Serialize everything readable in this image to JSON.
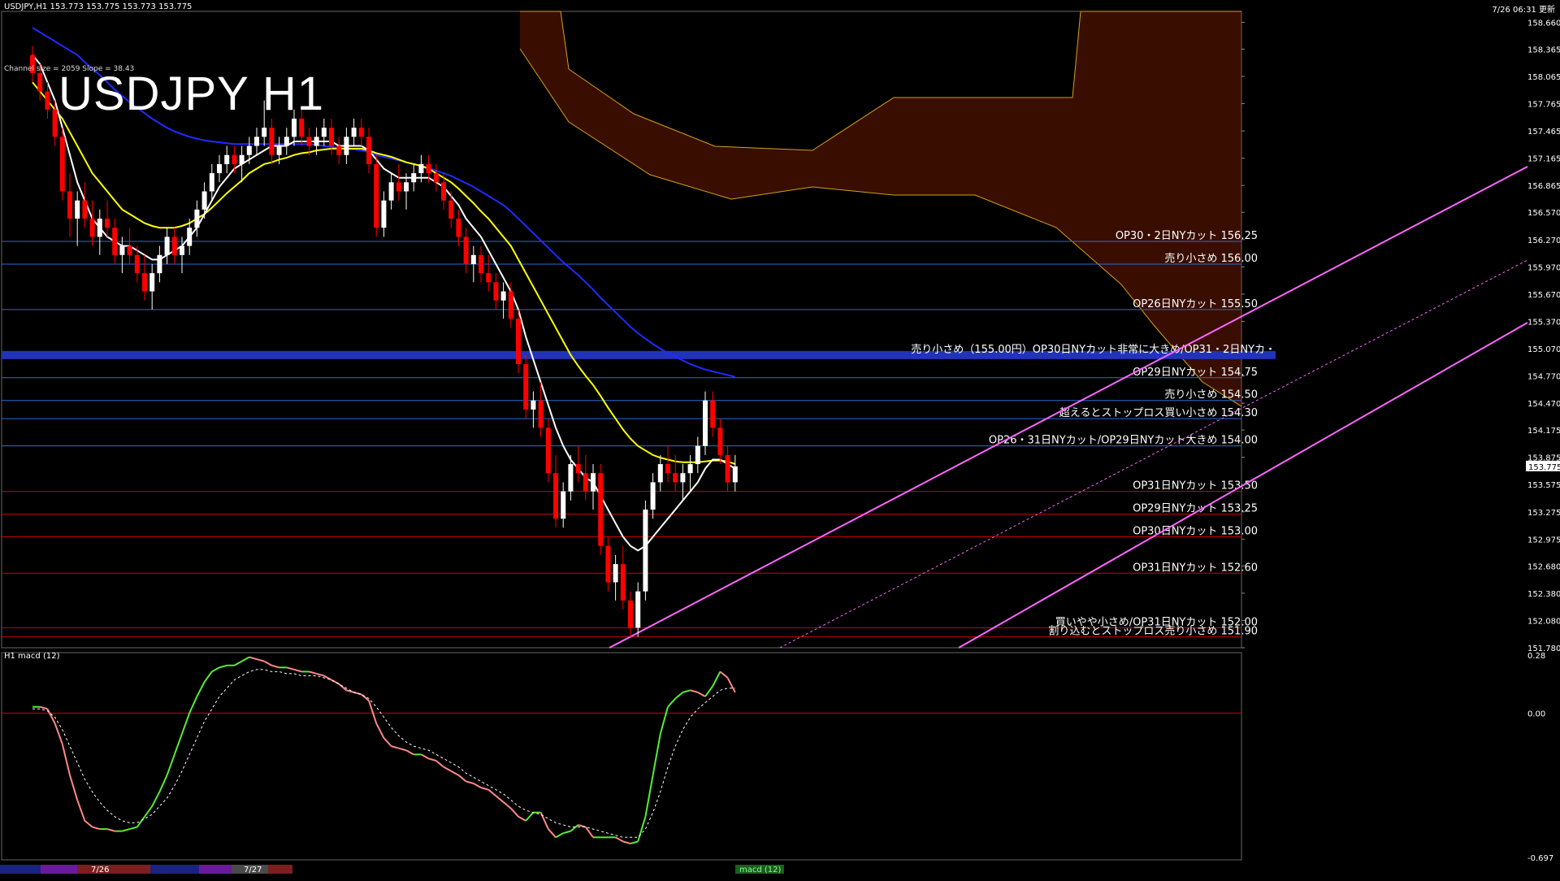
{
  "header": {
    "symbol_line": "USDJPY,H1  153.773 153.775 153.773 153.775",
    "timestamp": "7/26 06:31 更新",
    "indicator_note": "Channel size = 2059 Slope = 38.43",
    "big_title": "USDJPY H1",
    "macd_title": "H1  macd (12)"
  },
  "colors": {
    "background": "#000000",
    "bull_candle": "#ffffff",
    "bear_candle": "#ff0000",
    "sma_white": "#ffffff",
    "sma_yellow": "#ffff00",
    "sma_blue": "#1e2bff",
    "chikou_green": "#22cc22",
    "bollinger_red": "#cc0000",
    "kumo": "#cc3300",
    "channel_pink": "#ff66ff",
    "hline_blue": "#2a6dd9",
    "hline_red": "#cc0000",
    "macd_green": "#55ee33",
    "macd_pink": "#ff8888"
  },
  "chart_data": {
    "type": "candlestick",
    "ylim": [
      151.78,
      158.78
    ],
    "y_ticks": [
      "158.660",
      "158.365",
      "158.065",
      "157.765",
      "157.465",
      "157.165",
      "156.865",
      "156.570",
      "156.270",
      "155.970",
      "155.670",
      "155.370",
      "155.070",
      "154.770",
      "154.470",
      "154.175",
      "153.875",
      "153.575",
      "153.275",
      "152.975",
      "152.680",
      "152.380",
      "152.080",
      "151.780"
    ],
    "current_price": "153.775",
    "x_labels": [],
    "levels": [
      {
        "price": 156.25,
        "label": "OP30・2日NYカット 156.25",
        "color": "#2a6dd9"
      },
      {
        "price": 156.0,
        "label": "売り小さめ 156.00",
        "color": "#2a6dd9"
      },
      {
        "price": 155.5,
        "label": "OP26日NYカット 155.50",
        "color": "#2a6dd9"
      },
      {
        "price": 155.0,
        "label": "売り小さめ（155.00円）OP30日NYカット非常に大きめ/OP31・2日NYカ・",
        "color": "#2233bb",
        "band": true
      },
      {
        "price": 154.75,
        "label": "OP29日NYカット 154.75",
        "color": "#2a6dd9"
      },
      {
        "price": 154.5,
        "label": "売り小さめ 154.50",
        "color": "#2a6dd9"
      },
      {
        "price": 154.3,
        "label": "超えるとストップロス買い小さめ 154.30",
        "color": "#2a6dd9"
      },
      {
        "price": 154.0,
        "label": "OP26・31日NYカット/OP29日NYカット大きめ 154.00",
        "color": "#2a6dd9"
      },
      {
        "price": 153.5,
        "label": "OP31日NYカット 153.50",
        "color": "#cc0000"
      },
      {
        "price": 153.25,
        "label": "OP29日NYカット 153.25",
        "color": "#cc0000"
      },
      {
        "price": 153.0,
        "label": "OP30日NYカット 153.00",
        "color": "#cc0000"
      },
      {
        "price": 152.6,
        "label": "OP31日NYカット 152.60",
        "color": "#cc0000"
      },
      {
        "price": 152.0,
        "label": "買いやや小さめ/OP31日NYカット 152.00",
        "color": "#cc0000"
      },
      {
        "price": 151.9,
        "label": "割り込むとストップロス売り小さめ 151.90",
        "color": "#cc0000"
      }
    ],
    "candles": [
      [
        158.3,
        158.4,
        158.0,
        158.1
      ],
      [
        158.1,
        158.2,
        157.8,
        157.9
      ],
      [
        157.9,
        158.0,
        157.6,
        157.7
      ],
      [
        157.7,
        157.8,
        157.3,
        157.4
      ],
      [
        157.4,
        157.5,
        156.7,
        156.8
      ],
      [
        156.8,
        157.0,
        156.3,
        156.5
      ],
      [
        156.5,
        156.8,
        156.2,
        156.7
      ],
      [
        156.7,
        156.9,
        156.4,
        156.5
      ],
      [
        156.5,
        156.7,
        156.2,
        156.3
      ],
      [
        156.3,
        156.6,
        156.1,
        156.5
      ],
      [
        156.5,
        156.7,
        156.3,
        156.4
      ],
      [
        156.4,
        156.5,
        156.0,
        156.1
      ],
      [
        156.1,
        156.3,
        155.9,
        156.2
      ],
      [
        156.2,
        156.4,
        156.0,
        156.1
      ],
      [
        156.1,
        156.2,
        155.8,
        155.9
      ],
      [
        155.9,
        156.1,
        155.6,
        155.7
      ],
      [
        155.7,
        156.0,
        155.5,
        155.9
      ],
      [
        155.9,
        156.2,
        155.8,
        156.1
      ],
      [
        156.1,
        156.4,
        156.0,
        156.3
      ],
      [
        156.3,
        156.4,
        156.0,
        156.1
      ],
      [
        156.1,
        156.3,
        155.9,
        156.2
      ],
      [
        156.2,
        156.5,
        156.1,
        156.4
      ],
      [
        156.4,
        156.7,
        156.3,
        156.6
      ],
      [
        156.6,
        156.9,
        156.5,
        156.8
      ],
      [
        156.8,
        157.1,
        156.7,
        157.0
      ],
      [
        157.0,
        157.2,
        156.9,
        157.1
      ],
      [
        157.1,
        157.3,
        157.0,
        157.2
      ],
      [
        157.2,
        157.3,
        157.0,
        157.1
      ],
      [
        157.1,
        157.3,
        156.9,
        157.2
      ],
      [
        157.2,
        157.4,
        157.1,
        157.3
      ],
      [
        157.3,
        157.5,
        157.2,
        157.4
      ],
      [
        157.4,
        157.8,
        157.3,
        157.5
      ],
      [
        157.5,
        157.6,
        157.1,
        157.2
      ],
      [
        157.2,
        157.4,
        157.1,
        157.3
      ],
      [
        157.3,
        157.5,
        157.2,
        157.4
      ],
      [
        157.4,
        157.7,
        157.3,
        157.6
      ],
      [
        157.6,
        157.7,
        157.3,
        157.4
      ],
      [
        157.4,
        157.5,
        157.2,
        157.3
      ],
      [
        157.3,
        157.5,
        157.2,
        157.4
      ],
      [
        157.4,
        157.6,
        157.3,
        157.5
      ],
      [
        157.5,
        157.6,
        157.2,
        157.3
      ],
      [
        157.3,
        157.4,
        157.1,
        157.2
      ],
      [
        157.2,
        157.5,
        157.1,
        157.4
      ],
      [
        157.4,
        157.6,
        157.3,
        157.5
      ],
      [
        157.5,
        157.6,
        157.3,
        157.4
      ],
      [
        157.4,
        157.5,
        157.0,
        157.1
      ],
      [
        157.1,
        157.2,
        156.3,
        156.4
      ],
      [
        156.4,
        156.8,
        156.3,
        156.7
      ],
      [
        156.7,
        157.0,
        156.6,
        156.9
      ],
      [
        156.9,
        157.1,
        156.7,
        156.8
      ],
      [
        156.8,
        157.0,
        156.6,
        156.9
      ],
      [
        156.9,
        157.1,
        156.8,
        157.0
      ],
      [
        157.0,
        157.2,
        156.9,
        157.1
      ],
      [
        157.1,
        157.2,
        156.9,
        157.0
      ],
      [
        157.0,
        157.1,
        156.8,
        156.9
      ],
      [
        156.9,
        157.0,
        156.6,
        156.7
      ],
      [
        156.7,
        156.8,
        156.4,
        156.5
      ],
      [
        156.5,
        156.6,
        156.2,
        156.3
      ],
      [
        156.3,
        156.4,
        155.9,
        156.0
      ],
      [
        156.0,
        156.2,
        155.8,
        156.1
      ],
      [
        156.1,
        156.2,
        155.8,
        155.9
      ],
      [
        155.9,
        156.1,
        155.7,
        155.8
      ],
      [
        155.8,
        155.9,
        155.5,
        155.6
      ],
      [
        155.6,
        155.8,
        155.4,
        155.7
      ],
      [
        155.7,
        155.8,
        155.3,
        155.4
      ],
      [
        155.4,
        155.5,
        154.8,
        154.9
      ],
      [
        154.9,
        155.0,
        154.3,
        154.4
      ],
      [
        154.4,
        154.6,
        154.2,
        154.5
      ],
      [
        154.5,
        154.7,
        154.1,
        154.2
      ],
      [
        154.2,
        154.3,
        153.6,
        153.7
      ],
      [
        153.7,
        153.9,
        153.1,
        153.2
      ],
      [
        153.2,
        153.6,
        153.1,
        153.5
      ],
      [
        153.5,
        153.9,
        153.4,
        153.8
      ],
      [
        153.8,
        154.0,
        153.6,
        153.7
      ],
      [
        153.7,
        153.9,
        153.4,
        153.5
      ],
      [
        153.5,
        153.8,
        153.3,
        153.7
      ],
      [
        153.7,
        153.8,
        152.8,
        152.9
      ],
      [
        152.9,
        153.0,
        152.4,
        152.5
      ],
      [
        152.5,
        152.8,
        152.3,
        152.7
      ],
      [
        152.7,
        152.9,
        152.2,
        152.3
      ],
      [
        152.3,
        152.4,
        151.9,
        152.0
      ],
      [
        152.0,
        152.5,
        151.9,
        152.4
      ],
      [
        152.4,
        153.4,
        152.3,
        153.3
      ],
      [
        153.3,
        153.7,
        153.2,
        153.6
      ],
      [
        153.6,
        153.9,
        153.5,
        153.8
      ],
      [
        153.8,
        154.0,
        153.6,
        153.7
      ],
      [
        153.7,
        153.9,
        153.5,
        153.6
      ],
      [
        153.6,
        153.8,
        153.4,
        153.7
      ],
      [
        153.7,
        153.9,
        153.5,
        153.8
      ],
      [
        153.8,
        154.1,
        153.7,
        154.0
      ],
      [
        154.0,
        154.6,
        153.9,
        154.5
      ],
      [
        154.5,
        154.6,
        154.1,
        154.2
      ],
      [
        154.2,
        154.3,
        153.8,
        153.9
      ],
      [
        153.9,
        154.0,
        153.5,
        153.6
      ],
      [
        153.6,
        153.9,
        153.5,
        153.775
      ]
    ],
    "sma_white": [
      158.3,
      158.2,
      158.0,
      157.8,
      157.5,
      157.2,
      156.9,
      156.7,
      156.5,
      156.4,
      156.3,
      156.25,
      156.2,
      156.2,
      156.15,
      156.1,
      156.05,
      156.05,
      156.1,
      156.15,
      156.2,
      156.3,
      156.4,
      156.55,
      156.7,
      156.85,
      156.95,
      157.05,
      157.1,
      157.15,
      157.2,
      157.25,
      157.3,
      157.3,
      157.3,
      157.35,
      157.35,
      157.35,
      157.35,
      157.35,
      157.35,
      157.3,
      157.3,
      157.3,
      157.3,
      157.25,
      157.15,
      157.05,
      157.0,
      156.95,
      156.95,
      156.95,
      156.95,
      156.95,
      156.9,
      156.85,
      156.75,
      156.65,
      156.5,
      156.4,
      156.3,
      156.15,
      156.0,
      155.85,
      155.7,
      155.5,
      155.2,
      154.95,
      154.7,
      154.45,
      154.2,
      154.0,
      153.85,
      153.75,
      153.65,
      153.6,
      153.45,
      153.3,
      153.15,
      153.0,
      152.9,
      152.85,
      152.9,
      153.0,
      153.1,
      153.2,
      153.3,
      153.4,
      153.5,
      153.6,
      153.75,
      153.85,
      153.85,
      153.8,
      153.75
    ],
    "sma_yellow": [
      158.0,
      157.9,
      157.8,
      157.7,
      157.6,
      157.45,
      157.3,
      157.15,
      157.0,
      156.9,
      156.8,
      156.7,
      156.6,
      156.55,
      156.5,
      156.45,
      156.42,
      156.4,
      156.4,
      156.4,
      156.42,
      156.45,
      156.5,
      156.55,
      156.62,
      156.7,
      156.78,
      156.85,
      156.92,
      157.0,
      157.05,
      157.1,
      157.12,
      157.15,
      157.17,
      157.2,
      157.22,
      157.23,
      157.25,
      157.26,
      157.27,
      157.27,
      157.27,
      157.27,
      157.27,
      157.25,
      157.22,
      157.2,
      157.18,
      157.15,
      157.12,
      157.1,
      157.08,
      157.05,
      157.0,
      156.95,
      156.9,
      156.83,
      156.75,
      156.67,
      156.58,
      156.5,
      156.4,
      156.3,
      156.2,
      156.05,
      155.9,
      155.75,
      155.6,
      155.45,
      155.3,
      155.15,
      155.0,
      154.88,
      154.77,
      154.67,
      154.55,
      154.42,
      154.3,
      154.18,
      154.08,
      154.0,
      153.95,
      153.9,
      153.87,
      153.85,
      153.83,
      153.82,
      153.82,
      153.82,
      153.83,
      153.84,
      153.84,
      153.83,
      153.8
    ],
    "sma_blue": [
      158.6,
      158.55,
      158.5,
      158.45,
      158.4,
      158.35,
      158.3,
      158.22,
      158.15,
      158.08,
      158.0,
      157.92,
      157.85,
      157.78,
      157.72,
      157.66,
      157.6,
      157.55,
      157.5,
      157.46,
      157.43,
      157.4,
      157.38,
      157.36,
      157.35,
      157.34,
      157.33,
      157.32,
      157.32,
      157.32,
      157.32,
      157.32,
      157.32,
      157.32,
      157.32,
      157.32,
      157.32,
      157.32,
      157.31,
      157.3,
      157.29,
      157.28,
      157.27,
      157.26,
      157.25,
      157.23,
      157.2,
      157.18,
      157.16,
      157.14,
      157.12,
      157.1,
      157.08,
      157.06,
      157.03,
      157.0,
      156.97,
      156.93,
      156.89,
      156.85,
      156.8,
      156.75,
      156.7,
      156.65,
      156.58,
      156.5,
      156.42,
      156.34,
      156.26,
      156.18,
      156.1,
      156.02,
      155.95,
      155.88,
      155.8,
      155.72,
      155.63,
      155.55,
      155.47,
      155.39,
      155.31,
      155.24,
      155.18,
      155.12,
      155.07,
      155.02,
      154.98,
      154.94,
      154.9,
      154.87,
      154.84,
      154.82,
      154.8,
      154.78,
      154.76
    ],
    "macd_main": [
      0.03,
      0.03,
      0.02,
      -0.05,
      -0.15,
      -0.3,
      -0.42,
      -0.52,
      -0.55,
      -0.56,
      -0.56,
      -0.57,
      -0.57,
      -0.56,
      -0.55,
      -0.5,
      -0.45,
      -0.38,
      -0.3,
      -0.2,
      -0.1,
      0.0,
      0.08,
      0.15,
      0.2,
      0.22,
      0.23,
      0.23,
      0.25,
      0.27,
      0.26,
      0.25,
      0.23,
      0.22,
      0.22,
      0.21,
      0.2,
      0.2,
      0.19,
      0.18,
      0.16,
      0.14,
      0.11,
      0.1,
      0.09,
      0.06,
      -0.05,
      -0.12,
      -0.16,
      -0.17,
      -0.18,
      -0.2,
      -0.2,
      -0.22,
      -0.23,
      -0.26,
      -0.28,
      -0.3,
      -0.33,
      -0.34,
      -0.36,
      -0.37,
      -0.4,
      -0.43,
      -0.46,
      -0.5,
      -0.52,
      -0.48,
      -0.48,
      -0.56,
      -0.6,
      -0.58,
      -0.57,
      -0.54,
      -0.55,
      -0.6,
      -0.6,
      -0.6,
      -0.6,
      -0.62,
      -0.63,
      -0.62,
      -0.5,
      -0.3,
      -0.1,
      0.03,
      0.07,
      0.1,
      0.11,
      0.1,
      0.08,
      0.13,
      0.2,
      0.17,
      0.1
    ],
    "macd_signal": [
      0.02,
      0.02,
      0.01,
      -0.02,
      -0.08,
      -0.16,
      -0.24,
      -0.32,
      -0.38,
      -0.43,
      -0.47,
      -0.5,
      -0.52,
      -0.53,
      -0.53,
      -0.51,
      -0.49,
      -0.45,
      -0.41,
      -0.35,
      -0.28,
      -0.2,
      -0.12,
      -0.04,
      0.02,
      0.08,
      0.12,
      0.16,
      0.18,
      0.2,
      0.21,
      0.21,
      0.2,
      0.2,
      0.19,
      0.19,
      0.18,
      0.18,
      0.18,
      0.17,
      0.16,
      0.14,
      0.12,
      0.1,
      0.09,
      0.07,
      0.03,
      -0.02,
      -0.07,
      -0.11,
      -0.14,
      -0.16,
      -0.17,
      -0.18,
      -0.2,
      -0.22,
      -0.24,
      -0.26,
      -0.29,
      -0.31,
      -0.33,
      -0.35,
      -0.37,
      -0.39,
      -0.42,
      -0.45,
      -0.47,
      -0.48,
      -0.49,
      -0.51,
      -0.53,
      -0.54,
      -0.55,
      -0.55,
      -0.55,
      -0.56,
      -0.57,
      -0.58,
      -0.59,
      -0.6,
      -0.6,
      -0.6,
      -0.56,
      -0.48,
      -0.38,
      -0.26,
      -0.16,
      -0.08,
      -0.02,
      0.02,
      0.05,
      0.08,
      0.11,
      0.12,
      0.12
    ],
    "macd_ylim": [
      -0.697,
      0.28
    ],
    "macd_ticks": [
      "0.28",
      "0.00",
      "-0.697"
    ]
  },
  "tabs": [
    {
      "label": "7/26"
    },
    {
      "label": "7/27"
    }
  ],
  "bottom_tag": "macd (12)"
}
